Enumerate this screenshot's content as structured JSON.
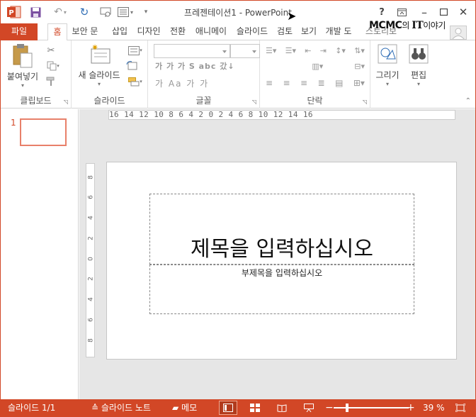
{
  "titlebar": {
    "title": "프레젠테이션1 - PowerPoint",
    "help": "?",
    "icons": [
      "powerpoint-logo",
      "save-icon",
      "undo-icon",
      "redo-icon",
      "present-icon",
      "layout-icon",
      "customize-icon"
    ]
  },
  "tabs": [
    {
      "label": "파일"
    },
    {
      "label": "홈"
    },
    {
      "label": "보안 문"
    },
    {
      "label": "삽입"
    },
    {
      "label": "디자인"
    },
    {
      "label": "전환"
    },
    {
      "label": "애니메이"
    },
    {
      "label": "슬라이드"
    },
    {
      "label": "검토"
    },
    {
      "label": "보기"
    },
    {
      "label": "개발 도"
    },
    {
      "label": "스토리보"
    }
  ],
  "brand": {
    "part1": "MCMC",
    "part2": "의 ",
    "part3": "IT",
    "part4": "이야기"
  },
  "ribbon": {
    "clipboard": {
      "label": "클립보드",
      "paste": "붙여넣기"
    },
    "slides": {
      "label": "슬라이드",
      "new_slide": "새 슬라이드"
    },
    "font": {
      "label": "글꼴",
      "row1": "가  가  가  S  abc  갔↓",
      "row2": "가  Aa  가  가"
    },
    "paragraph": {
      "label": "단락"
    },
    "drawing": {
      "label": "그리기"
    },
    "editing": {
      "label": "편집"
    }
  },
  "ruler": {
    "horizontal": "16 14 12 10 8 6 4 2 0 2 4 6 8 10 12 14 16",
    "vertical": [
      "8",
      "6",
      "4",
      "2",
      "0",
      "2",
      "4",
      "6",
      "8"
    ]
  },
  "thumbnails": [
    {
      "number": "1"
    }
  ],
  "slide": {
    "title_placeholder": "제목을 입력하십시오",
    "subtitle_placeholder": "부제목을 입력하십시오"
  },
  "status": {
    "slide_info": "슬라이드 1/1",
    "notes": "슬라이드 노트",
    "comments": "메모",
    "zoom_minus": "−",
    "zoom_plus": "+",
    "zoom": "39 %",
    "zoom_fraction": 0.39
  },
  "colors": {
    "accent": "#d24726"
  }
}
